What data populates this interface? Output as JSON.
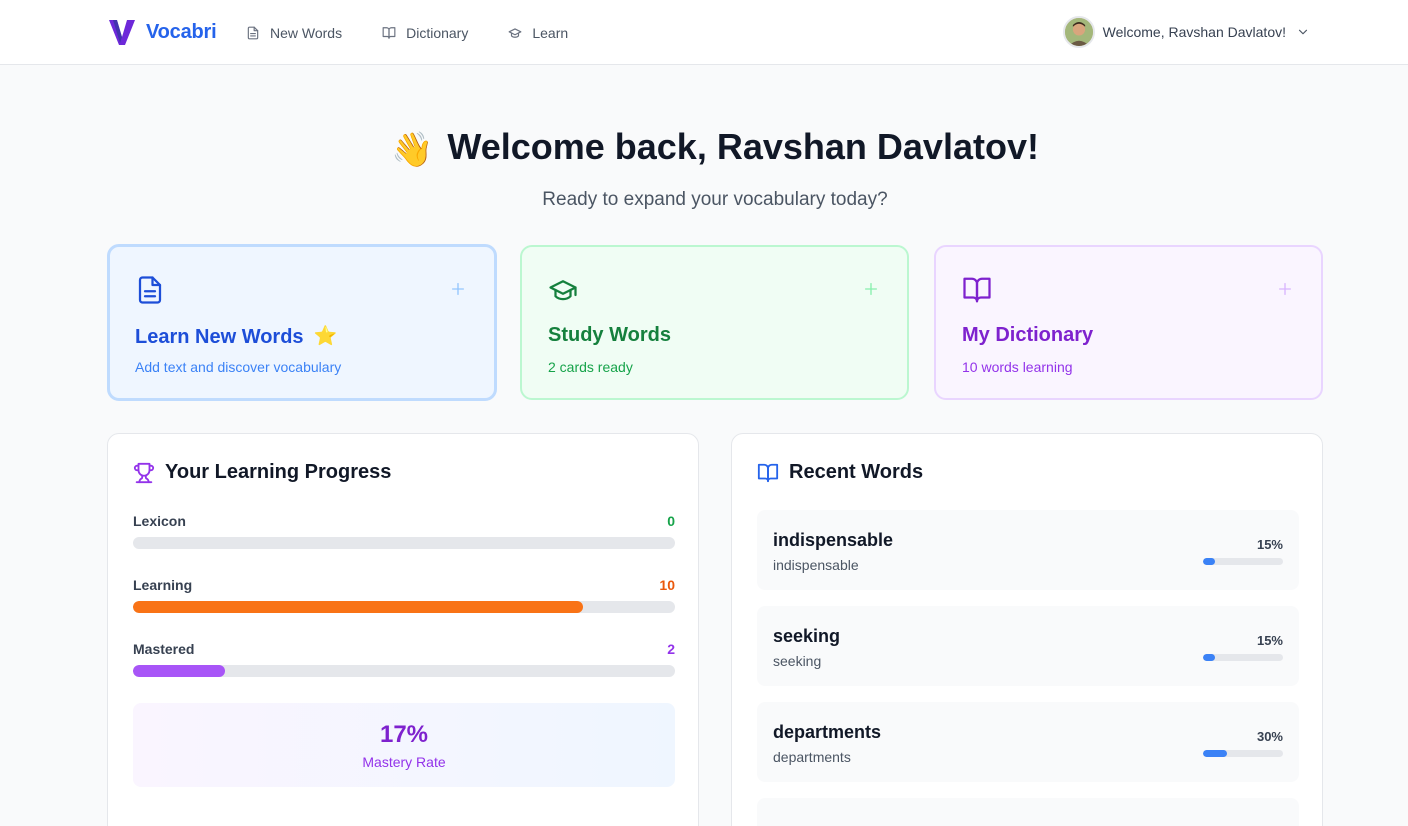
{
  "header": {
    "brand": "Vocabri",
    "nav": [
      {
        "label": "New Words",
        "icon": "file-text-icon"
      },
      {
        "label": "Dictionary",
        "icon": "book-open-icon"
      },
      {
        "label": "Learn",
        "icon": "graduation-cap-icon"
      }
    ],
    "user_greeting": "Welcome, Ravshan Davlatov!"
  },
  "hero": {
    "emoji": "👋",
    "title": "Welcome back, Ravshan Davlatov!",
    "subtitle": "Ready to expand your vocabulary today?"
  },
  "cards": [
    {
      "title": "Learn New Words",
      "subtitle": "Add text and discover vocabulary",
      "badge": "⭐",
      "icon": "file-text-icon",
      "color": "#1d4ed8"
    },
    {
      "title": "Study Words",
      "subtitle": "2 cards ready",
      "icon": "graduation-cap-icon",
      "color": "#15803d"
    },
    {
      "title": "My Dictionary",
      "subtitle": "10 words learning",
      "icon": "book-open-icon",
      "color": "#7e22ce"
    }
  ],
  "progress": {
    "title": "Your Learning Progress",
    "rows": [
      {
        "label": "Lexicon",
        "value": "0",
        "percent": 0,
        "color": "#16a34a"
      },
      {
        "label": "Learning",
        "value": "10",
        "percent": 83,
        "color": "#f97316"
      },
      {
        "label": "Mastered",
        "value": "2",
        "percent": 17,
        "color": "#a855f7"
      }
    ],
    "mastery_value": "17%",
    "mastery_label": "Mastery Rate"
  },
  "recent": {
    "title": "Recent Words",
    "words": [
      {
        "term": "indispensable",
        "translation": "indispensable",
        "percent_label": "15%",
        "percent": 15
      },
      {
        "term": "seeking",
        "translation": "seeking",
        "percent_label": "15%",
        "percent": 15
      },
      {
        "term": "departments",
        "translation": "departments",
        "percent_label": "30%",
        "percent": 30
      },
      {
        "term": "",
        "translation": "",
        "percent_label": "",
        "percent": 0
      }
    ]
  }
}
